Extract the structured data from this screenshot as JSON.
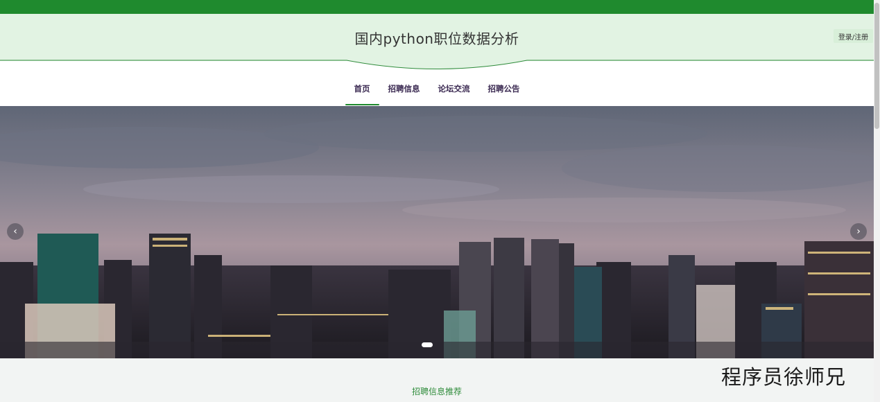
{
  "header": {
    "site_title": "国内python职位数据分析",
    "login_label": "登录/注册"
  },
  "nav": {
    "items": [
      {
        "label": "首页",
        "active": true
      },
      {
        "label": "招聘信息",
        "active": false
      },
      {
        "label": "论坛交流",
        "active": false
      },
      {
        "label": "招聘公告",
        "active": false
      }
    ]
  },
  "banner": {
    "prev_icon": "chevron-left-icon",
    "next_icon": "chevron-right-icon",
    "prev_glyph": "‹",
    "next_glyph": "›",
    "slide_count": 1,
    "active_slide": 1
  },
  "section": {
    "title": "招聘信息推荐"
  },
  "watermark": "程序员徐师兄",
  "colors": {
    "brand_green": "#1f8a2e",
    "header_bg": "#e2f3e3",
    "nav_text": "#3b2a52",
    "section_title": "#2e8b3a"
  }
}
